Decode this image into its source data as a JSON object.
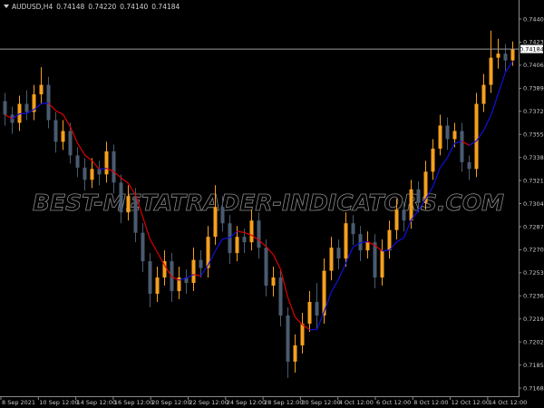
{
  "header": {
    "symbol": "AUDUSD,H4",
    "open": "0.74148",
    "high": "0.74220",
    "low": "0.74140",
    "close": "0.74184"
  },
  "watermark": "BEST-METATRADER-INDICATORS.COM",
  "colors": {
    "background": "#000000",
    "bull_candle": "#f5a01e",
    "bear_candle": "#4a5b70",
    "ma_falling": "#e00000",
    "ma_rising": "#1010e0",
    "axis": "#8a8a8a",
    "price_line": "#9a9a9a"
  },
  "chart_data": {
    "type": "candlestick",
    "symbol": "AUDUSD",
    "timeframe": "H4",
    "current_price": "0.74184",
    "ylim": [
      0.716,
      0.745
    ],
    "y_ticks": [
      "0.74405",
      "0.74235",
      "0.74065",
      "0.73895",
      "0.73725",
      "0.73555",
      "0.73385",
      "0.73215",
      "0.73045",
      "0.72875",
      "0.72705",
      "0.72535",
      "0.72365",
      "0.72195",
      "0.72025",
      "0.71855",
      "0.71685"
    ],
    "x_ticks": [
      "8 Sep 2021",
      "10 Sep 12:00",
      "14 Sep 12:00",
      "16 Sep 12:00",
      "20 Sep 12:00",
      "22 Sep 12:00",
      "24 Sep 12:00",
      "28 Sep 12:00",
      "30 Sep 12:00",
      "4 Oct 12:00",
      "6 Oct 12:00",
      "8 Oct 12:00",
      "12 Oct 12:00",
      "14 Oct 12:00"
    ],
    "candles_ohlc": [
      [
        0.738,
        0.7386,
        0.7362,
        0.737
      ],
      [
        0.737,
        0.7376,
        0.7356,
        0.7364
      ],
      [
        0.7364,
        0.7384,
        0.7358,
        0.7378
      ],
      [
        0.7378,
        0.7388,
        0.7366,
        0.7372
      ],
      [
        0.7372,
        0.7392,
        0.7366,
        0.7385
      ],
      [
        0.7385,
        0.7405,
        0.7378,
        0.7392
      ],
      [
        0.7392,
        0.7398,
        0.736,
        0.7366
      ],
      [
        0.7366,
        0.7372,
        0.7342,
        0.735
      ],
      [
        0.735,
        0.7366,
        0.7344,
        0.7358
      ],
      [
        0.7358,
        0.7364,
        0.7334,
        0.734
      ],
      [
        0.734,
        0.7346,
        0.7324,
        0.7331
      ],
      [
        0.7331,
        0.7338,
        0.7314,
        0.7322
      ],
      [
        0.7322,
        0.7338,
        0.7316,
        0.733
      ],
      [
        0.733,
        0.7336,
        0.7318,
        0.7326
      ],
      [
        0.7326,
        0.735,
        0.732,
        0.7343
      ],
      [
        0.7343,
        0.7348,
        0.7312,
        0.732
      ],
      [
        0.732,
        0.7326,
        0.729,
        0.7298
      ],
      [
        0.7298,
        0.7318,
        0.7292,
        0.731
      ],
      [
        0.731,
        0.7316,
        0.7276,
        0.7283
      ],
      [
        0.7283,
        0.729,
        0.7254,
        0.7262
      ],
      [
        0.7262,
        0.7268,
        0.7228,
        0.7238
      ],
      [
        0.7238,
        0.7258,
        0.7232,
        0.725
      ],
      [
        0.725,
        0.727,
        0.7244,
        0.7262
      ],
      [
        0.7262,
        0.7268,
        0.7232,
        0.724
      ],
      [
        0.724,
        0.7258,
        0.7234,
        0.725
      ],
      [
        0.725,
        0.7256,
        0.7238,
        0.7246
      ],
      [
        0.7246,
        0.7272,
        0.724,
        0.7263
      ],
      [
        0.7263,
        0.727,
        0.725,
        0.7257
      ],
      [
        0.7257,
        0.7288,
        0.725,
        0.728
      ],
      [
        0.728,
        0.7318,
        0.7274,
        0.7302
      ],
      [
        0.7302,
        0.731,
        0.7284,
        0.729
      ],
      [
        0.729,
        0.7296,
        0.726,
        0.7268
      ],
      [
        0.7268,
        0.7288,
        0.7262,
        0.728
      ],
      [
        0.728,
        0.7286,
        0.7268,
        0.7276
      ],
      [
        0.7276,
        0.73,
        0.727,
        0.7292
      ],
      [
        0.7292,
        0.7298,
        0.7264,
        0.7272
      ],
      [
        0.7272,
        0.7278,
        0.7236,
        0.7244
      ],
      [
        0.7244,
        0.7258,
        0.7236,
        0.725
      ],
      [
        0.725,
        0.7256,
        0.7214,
        0.7222
      ],
      [
        0.7222,
        0.7228,
        0.7176,
        0.7188
      ],
      [
        0.7188,
        0.7208,
        0.718,
        0.72
      ],
      [
        0.72,
        0.7224,
        0.7194,
        0.7216
      ],
      [
        0.7216,
        0.724,
        0.721,
        0.7232
      ],
      [
        0.7232,
        0.7246,
        0.7212,
        0.7222
      ],
      [
        0.7222,
        0.7264,
        0.7216,
        0.7255
      ],
      [
        0.7255,
        0.728,
        0.7248,
        0.7272
      ],
      [
        0.7272,
        0.7278,
        0.7256,
        0.7264
      ],
      [
        0.7264,
        0.7298,
        0.7258,
        0.729
      ],
      [
        0.729,
        0.7296,
        0.7274,
        0.7282
      ],
      [
        0.7282,
        0.7288,
        0.7262,
        0.727
      ],
      [
        0.727,
        0.7284,
        0.7264,
        0.7276
      ],
      [
        0.7276,
        0.7282,
        0.7242,
        0.725
      ],
      [
        0.725,
        0.7278,
        0.7244,
        0.727
      ],
      [
        0.727,
        0.7292,
        0.7264,
        0.7285
      ],
      [
        0.7285,
        0.7308,
        0.7278,
        0.73
      ],
      [
        0.73,
        0.7306,
        0.7284,
        0.7292
      ],
      [
        0.7292,
        0.7322,
        0.7286,
        0.7315
      ],
      [
        0.7315,
        0.7321,
        0.7298,
        0.7305
      ],
      [
        0.7305,
        0.7336,
        0.73,
        0.7328
      ],
      [
        0.7328,
        0.7352,
        0.7322,
        0.7345
      ],
      [
        0.7345,
        0.737,
        0.734,
        0.7362
      ],
      [
        0.7362,
        0.7368,
        0.7344,
        0.7352
      ],
      [
        0.7352,
        0.7364,
        0.7346,
        0.7358
      ],
      [
        0.7358,
        0.7364,
        0.7328,
        0.7335
      ],
      [
        0.7335,
        0.734,
        0.7322,
        0.733
      ],
      [
        0.733,
        0.7386,
        0.7324,
        0.7378
      ],
      [
        0.7378,
        0.74,
        0.7372,
        0.7392
      ],
      [
        0.7392,
        0.7432,
        0.7386,
        0.7412
      ],
      [
        0.7412,
        0.7426,
        0.7404,
        0.7415
      ],
      [
        0.7415,
        0.7422,
        0.7402,
        0.741
      ],
      [
        0.741,
        0.7424,
        0.7406,
        0.74184
      ]
    ]
  }
}
